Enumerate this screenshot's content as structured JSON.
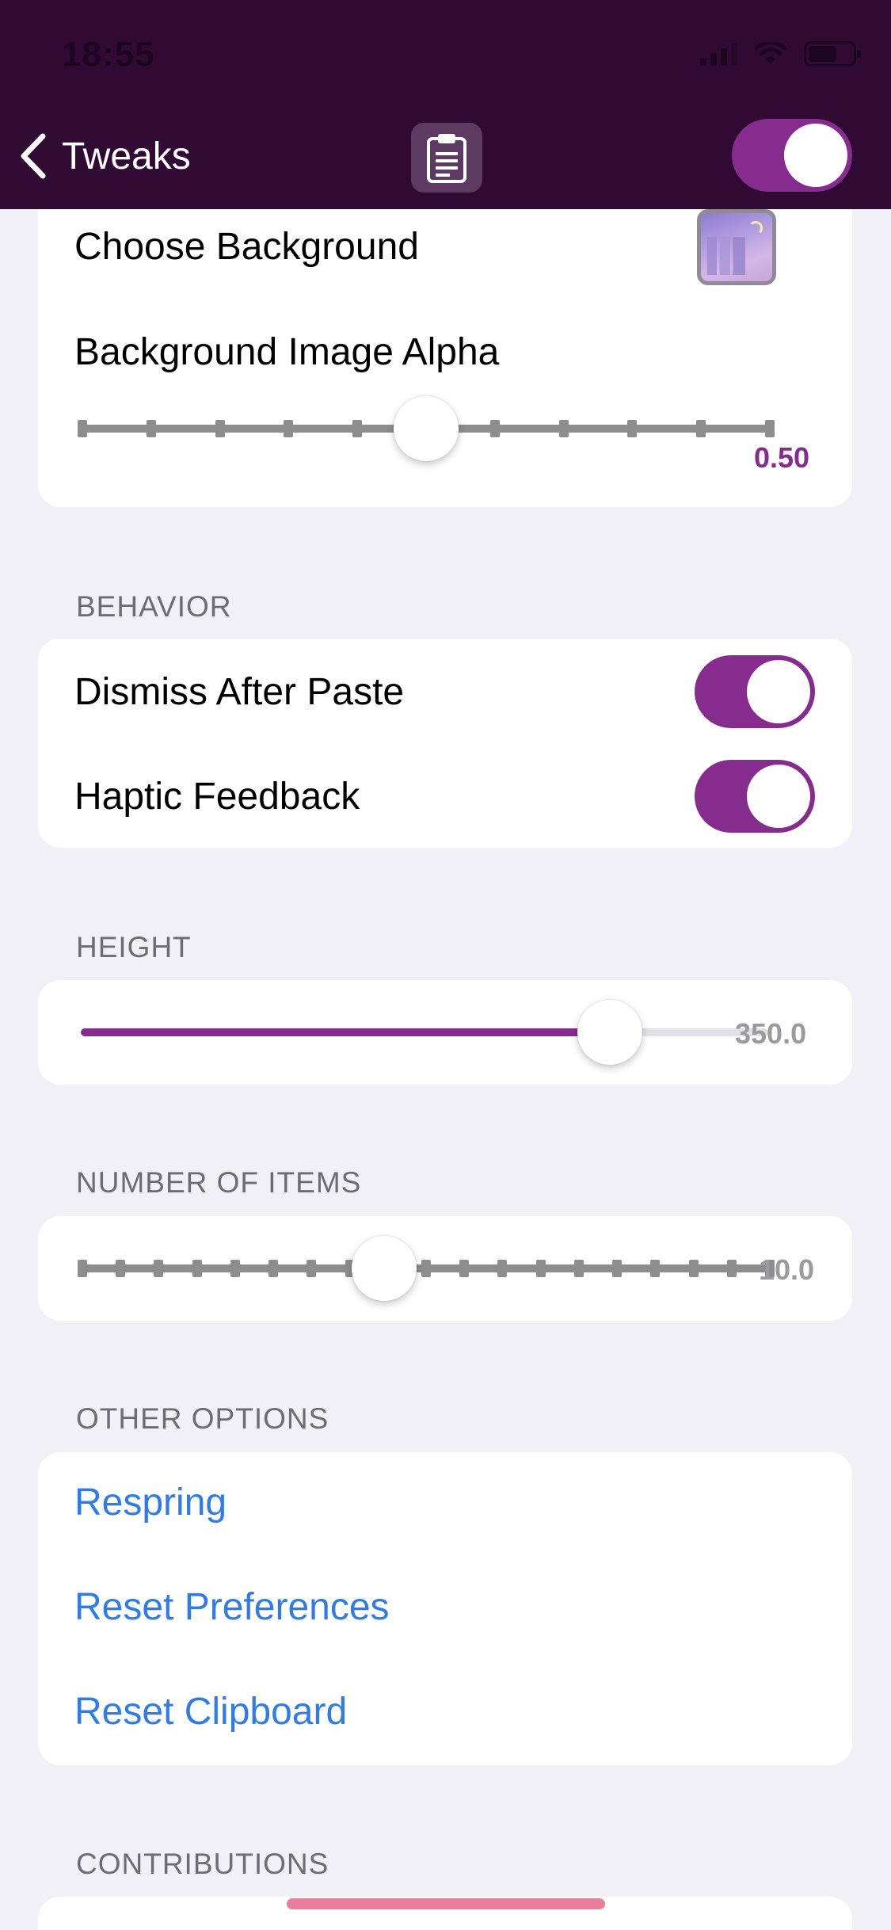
{
  "status_bar": {
    "time": "18:55"
  },
  "nav": {
    "back_label": "Tweaks",
    "enabled": true
  },
  "appearance": {
    "choose_background_label": "Choose Background",
    "alpha_label": "Background Image Alpha",
    "alpha_value_text": "0.50",
    "alpha_value": 0.5
  },
  "behavior": {
    "header": "BEHAVIOR",
    "dismiss_after_paste_label": "Dismiss After Paste",
    "dismiss_after_paste_on": true,
    "haptic_feedback_label": "Haptic Feedback",
    "haptic_feedback_on": true
  },
  "height": {
    "header": "HEIGHT",
    "value_text": "350.0",
    "fraction": 0.77
  },
  "items": {
    "header": "NUMBER OF ITEMS",
    "value_text": "10.0",
    "fraction": 0.44
  },
  "other": {
    "header": "OTHER OPTIONS",
    "respring": "Respring",
    "reset_preferences": "Reset Preferences",
    "reset_clipboard": "Reset Clipboard"
  },
  "contributions": {
    "header": "CONTRIBUTIONS"
  },
  "colors": {
    "accent": "#872c8f",
    "nav_bg": "#310a33",
    "link": "#2f7ce8",
    "group_bg": "#f1f0f6"
  },
  "icons": {
    "back": "chevron-left-icon",
    "clipboard": "clipboard-icon",
    "signal": "cellular-signal-icon",
    "wifi": "wifi-icon",
    "battery": "battery-icon"
  }
}
